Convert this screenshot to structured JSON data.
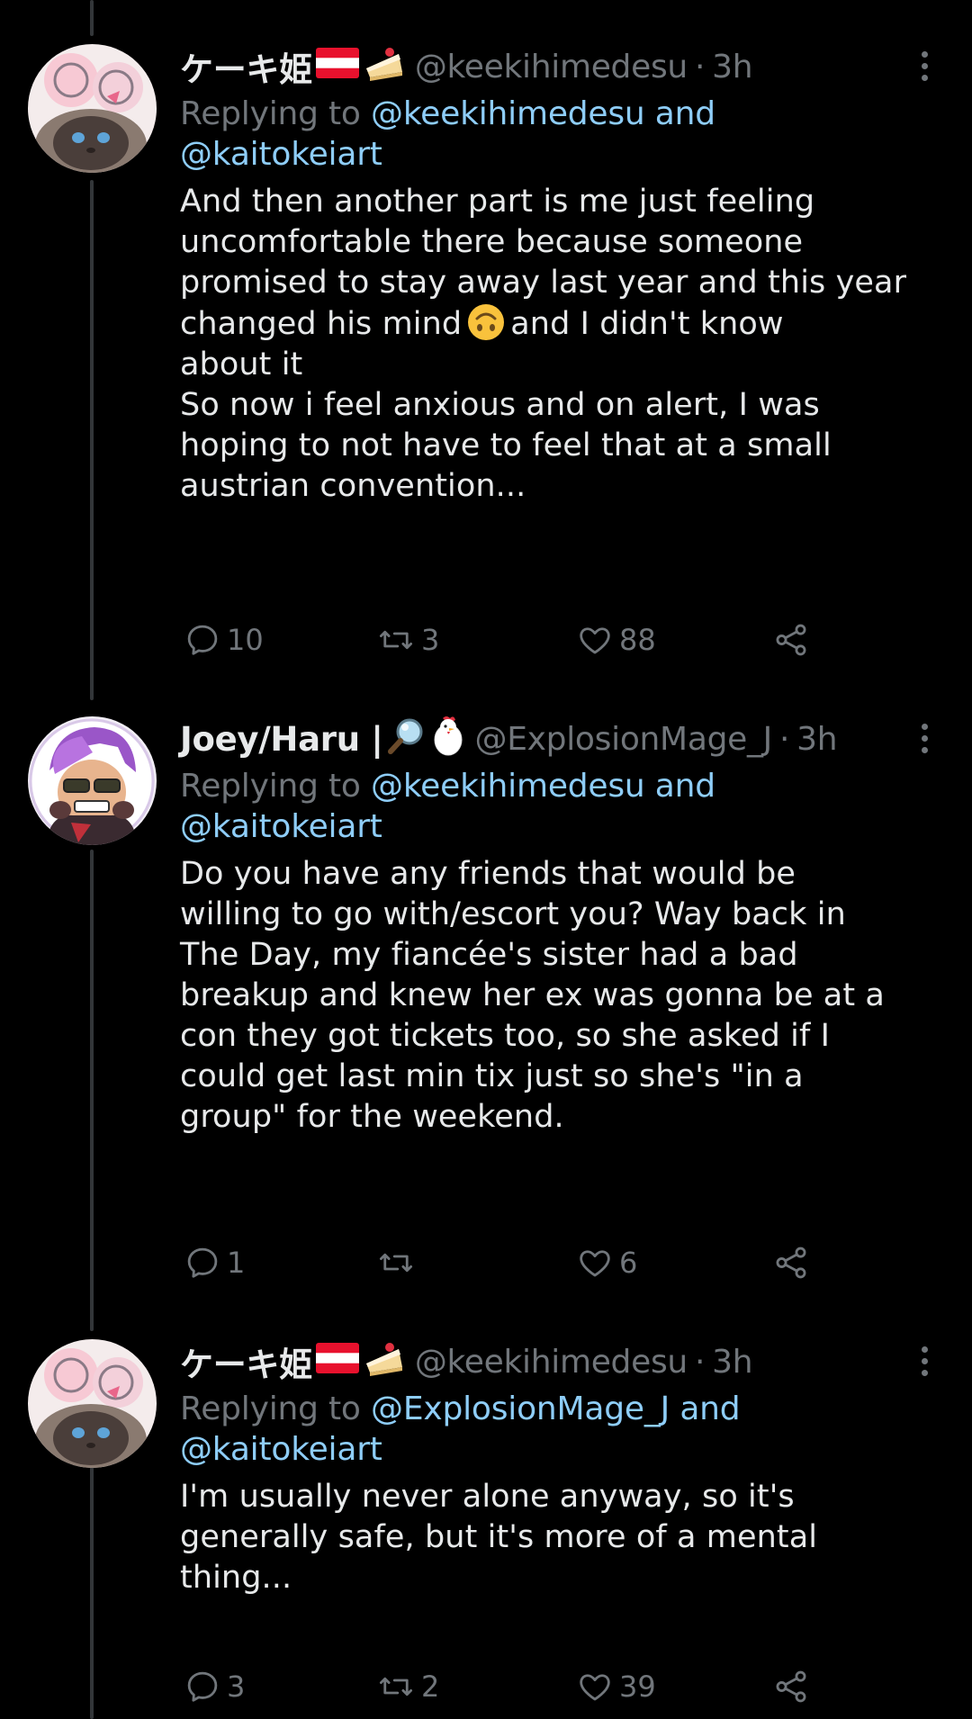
{
  "tweets": [
    {
      "display_name": "ケーキ姫",
      "handle": "@keekihimedesu",
      "dot": "·",
      "time": "3h",
      "replying_prefix": "Replying to ",
      "replying_link_1": "@keekihimedesu and",
      "replying_link_2": "@kaitokeiart",
      "body_line_1": "And then another part is me just feeling",
      "body_line_2": "uncomfortable there because someone",
      "body_line_3": "promised to stay away last year and this year",
      "body_line_4a": "changed his mind",
      "body_line_4b": "and I didn't know",
      "body_line_5": "about it",
      "body_line_6": "So now i feel anxious and on alert, I was",
      "body_line_7": "hoping to not have to feel that at a small",
      "body_line_8": "austrian convention...",
      "replies": "10",
      "retweets": "3",
      "likes": "88"
    },
    {
      "display_name": "Joey/Haru |",
      "handle": "@ExplosionMage_J",
      "dot": "·",
      "time": "3h",
      "replying_prefix": "Replying to ",
      "replying_link_1": "@keekihimedesu and",
      "replying_link_2": "@kaitokeiart",
      "body_line_1": "Do you have any friends that would be",
      "body_line_2": "willing to go with/escort you? Way back in",
      "body_line_3": "The Day, my fiancée's sister had a bad",
      "body_line_4": "breakup and knew her ex was gonna be at a",
      "body_line_5": "con they got tickets too, so she asked if I",
      "body_line_6": "could get last min tix just so she's \"in a",
      "body_line_7": "group\" for the weekend.",
      "replies": "1",
      "retweets": "",
      "likes": "6"
    },
    {
      "display_name": "ケーキ姫",
      "handle": "@keekihimedesu",
      "dot": "·",
      "time": "3h",
      "replying_prefix": "Replying to ",
      "replying_link_1": "@ExplosionMage_J and",
      "replying_link_2": "@kaitokeiart",
      "body_line_1": "I'm usually never alone anyway, so it's",
      "body_line_2": "generally safe, but it's more of a mental",
      "body_line_3": "thing...",
      "replies": "3",
      "retweets": "2",
      "likes": "39"
    }
  ],
  "colors": {
    "background": "#000000",
    "text": "#e7e9ea",
    "secondary": "#71767b",
    "link": "#8ecdf8",
    "thread_line": "#333639"
  },
  "icons": [
    "reply-icon",
    "retweet-icon",
    "like-icon",
    "share-icon",
    "more-icon",
    "austria-flag-icon",
    "cake-icon",
    "magnifier-icon",
    "chicken-icon",
    "upside-down-face-icon"
  ]
}
